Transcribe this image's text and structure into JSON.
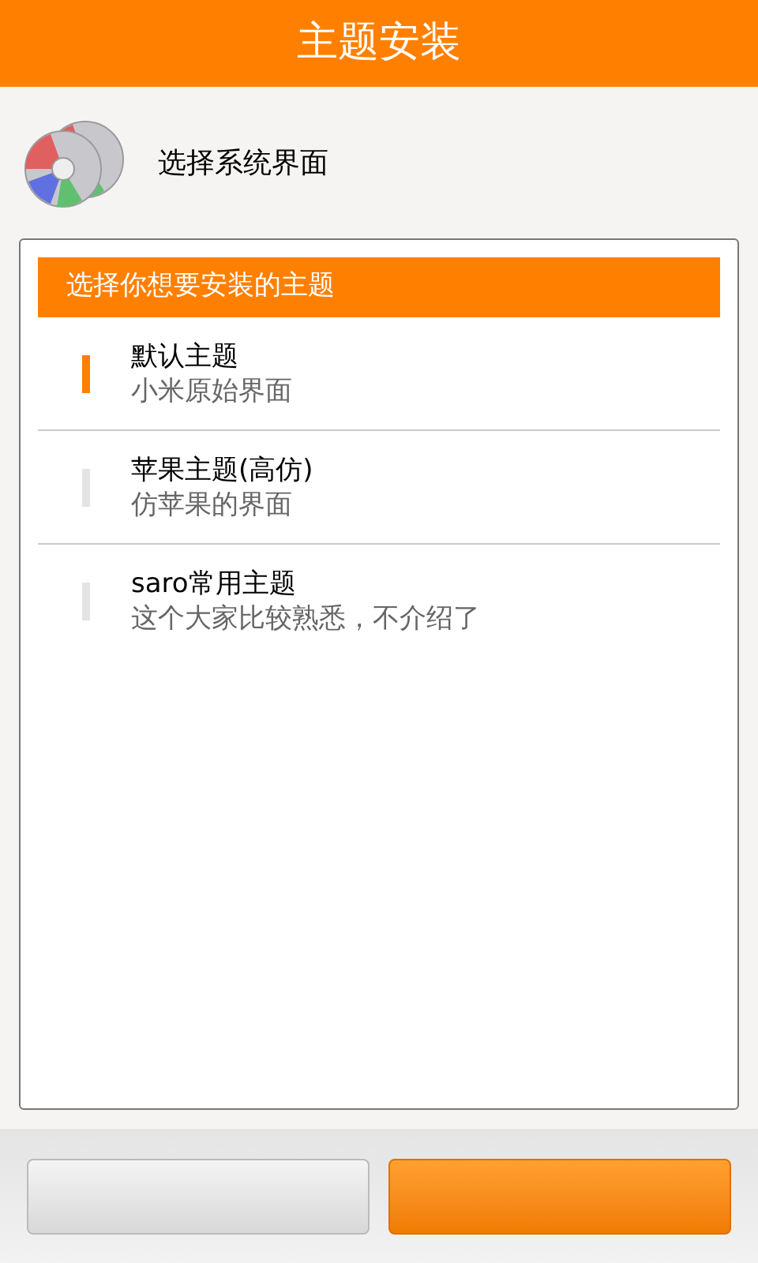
{
  "title_bar": {
    "title": "主题安装"
  },
  "header": {
    "label": "选择系统界面"
  },
  "theme_list": {
    "heading": "选择你想要安装的主题",
    "items": [
      {
        "name": "默认主题",
        "description": "小米原始界面",
        "selected": true
      },
      {
        "name": "苹果主题(高仿)",
        "description": "仿苹果的界面",
        "selected": false
      },
      {
        "name": "saro常用主题",
        "description": "这个大家比较熟悉，不介绍了",
        "selected": false
      }
    ]
  },
  "buttons": [
    {
      "kind": "secondary"
    },
    {
      "kind": "primary"
    }
  ]
}
